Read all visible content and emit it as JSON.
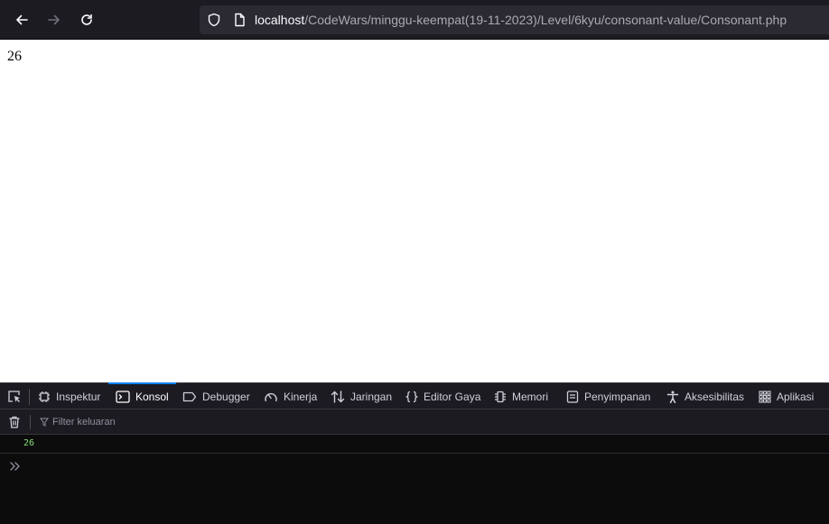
{
  "browser": {
    "back_icon": "arrow-left-icon",
    "forward_icon": "arrow-right-icon",
    "reload_icon": "reload-icon",
    "url_host": "localhost",
    "url_path": "/CodeWars/minggu-keempat(19-11-2023)/Level/6kyu/consonant-value/Consonant.php"
  },
  "page": {
    "output": "26"
  },
  "devtools": {
    "tabs": [
      {
        "label": "Inspektur",
        "icon": "inspector-icon"
      },
      {
        "label": "Konsol",
        "icon": "console-icon",
        "active": true
      },
      {
        "label": "Debugger",
        "icon": "debugger-icon"
      },
      {
        "label": "Kinerja",
        "icon": "performance-icon"
      },
      {
        "label": "Jaringan",
        "icon": "network-icon"
      },
      {
        "label": "Editor Gaya",
        "icon": "style-editor-icon"
      },
      {
        "label": "Memori",
        "icon": "memory-icon"
      },
      {
        "label": "Penyimpanan",
        "icon": "storage-icon"
      },
      {
        "label": "Aksesibilitas",
        "icon": "accessibility-icon"
      },
      {
        "label": "Aplikasi",
        "icon": "application-icon"
      }
    ],
    "filter_placeholder": "Filter keluaran",
    "console_messages": [
      "26"
    ],
    "accent_color": "#0a84ff",
    "log_value_color": "#86de74"
  }
}
